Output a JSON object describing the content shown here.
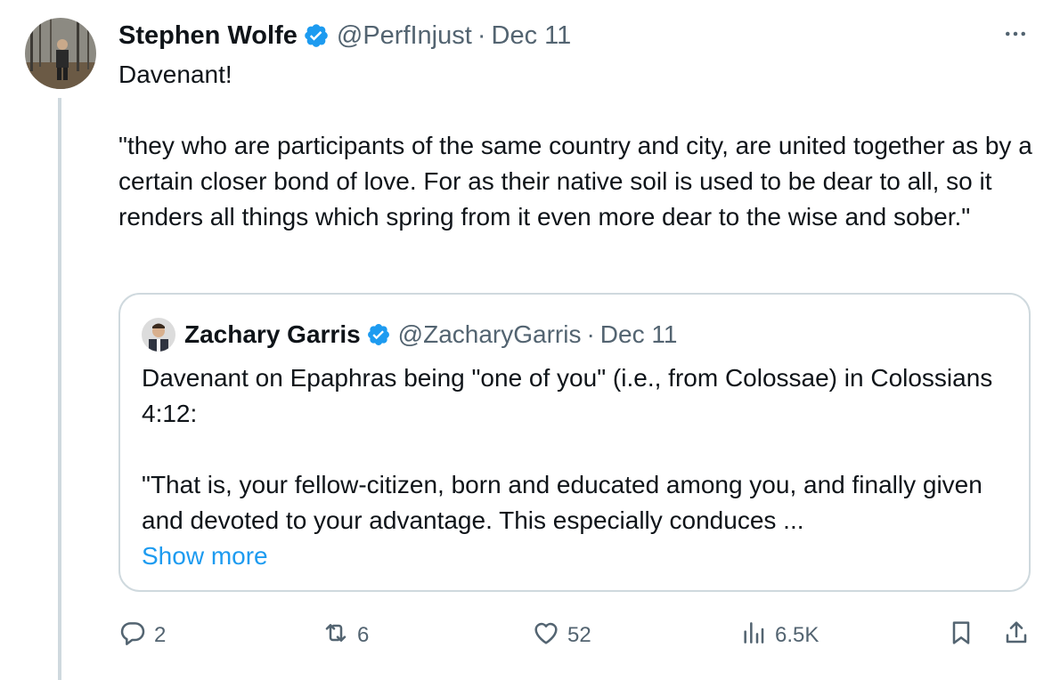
{
  "tweet": {
    "author_name": "Stephen Wolfe",
    "handle": "@PerfInjust",
    "separator": "·",
    "date": "Dec 11",
    "paragraphs": [
      "Davenant!",
      "\"they who are participants of the same country and city, are united together as by a certain closer bond of love. For as their native soil is used to be dear to all, so it renders all things which spring from it even more dear to the wise and sober.\""
    ]
  },
  "quote": {
    "author_name": "Zachary Garris",
    "handle": "@ZacharyGarris",
    "separator": "·",
    "date": "Dec 11",
    "paragraphs": [
      "Davenant on Epaphras being \"one of you\" (i.e., from Colossae) in Colossians 4:12:",
      "\"That is, your fellow-citizen, born and educated among you, and finally given and devoted to your advantage. This especially conduces ..."
    ],
    "show_more": "Show more"
  },
  "actions": {
    "reply_count": "2",
    "retweet_count": "6",
    "like_count": "52",
    "views_count": "6.5K"
  },
  "colors": {
    "text": "#0f1419",
    "secondary": "#536471",
    "accent": "#1d9bf0",
    "border": "#cfd9de"
  },
  "icons": {
    "verified": "verified-badge-icon",
    "more": "more-horizontal-icon",
    "reply": "reply-icon",
    "retweet": "retweet-icon",
    "like": "heart-icon",
    "views": "views-bar-icon",
    "bookmark": "bookmark-icon",
    "share": "share-icon"
  }
}
